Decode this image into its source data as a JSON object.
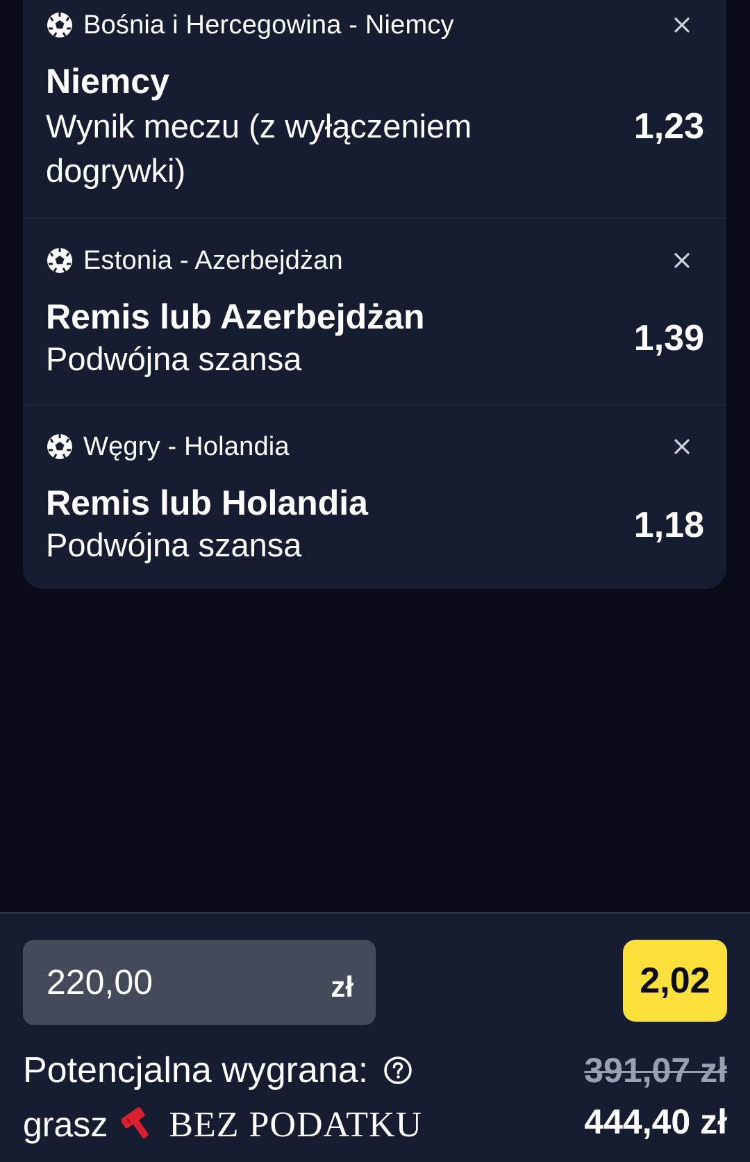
{
  "bets": [
    {
      "match": "Bośnia i Hercegowina - Niemcy",
      "selection": "Niemcy",
      "market": "Wynik meczu (z wyłączeniem dogrywki)",
      "odds": "1,23",
      "sport_icon": "soccer-ball-icon",
      "remove_icon": "close-icon"
    },
    {
      "match": "Estonia - Azerbejdżan",
      "selection": "Remis lub Azerbejdżan",
      "market": "Podwójna szansa",
      "odds": "1,39",
      "sport_icon": "soccer-ball-icon",
      "remove_icon": "close-icon"
    },
    {
      "match": "Węgry - Holandia",
      "selection": "Remis lub Holandia",
      "market": "Podwójna szansa",
      "odds": "1,18",
      "sport_icon": "soccer-ball-icon",
      "remove_icon": "close-icon"
    }
  ],
  "stake": {
    "value": "220,00",
    "currency": "zł"
  },
  "total_odds": "2,02",
  "potential_win": {
    "label": "Potencjalna wygrana:",
    "help_icon": "question-circle-icon",
    "old_amount": "391,07 zł",
    "new_amount": "444,40 zł"
  },
  "tax_promo": {
    "prefix": "grasz",
    "icon": "hammer-icon",
    "text": "BEZ PODATKU"
  },
  "colors": {
    "background": "#090b18",
    "card": "#171d31",
    "stake_box": "#454a5b",
    "odds_highlight": "#fbdf3b",
    "strikethrough_text": "#9aa0ae",
    "hammer_red": "#d8202e"
  }
}
